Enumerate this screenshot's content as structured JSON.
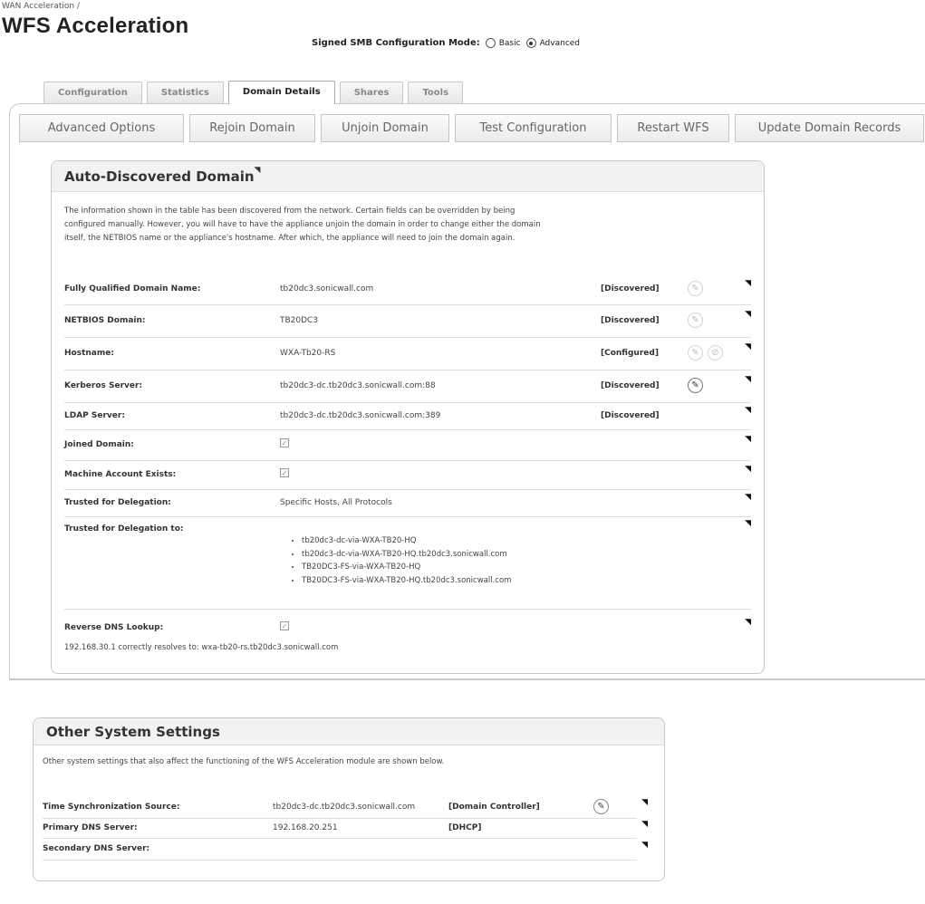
{
  "breadcrumb": "WAN Acceleration /",
  "title": "WFS Acceleration",
  "smb_mode": {
    "label": "Signed SMB Configuration Mode:",
    "options": [
      {
        "label": "Basic",
        "selected": false
      },
      {
        "label": "Advanced",
        "selected": true
      }
    ]
  },
  "tabs": [
    {
      "label": "Configuration",
      "active": false
    },
    {
      "label": "Statistics",
      "active": false
    },
    {
      "label": "Domain Details",
      "active": true
    },
    {
      "label": "Shares",
      "active": false
    },
    {
      "label": "Tools",
      "active": false
    }
  ],
  "buttons": [
    "Advanced Options",
    "Rejoin Domain",
    "Unjoin Domain",
    "Test Configuration",
    "Restart WFS",
    "Update Domain Records"
  ],
  "auto_domain": {
    "title": "Auto-Discovered Domain",
    "description_lines": [
      "The information shown in the table has been discovered from the network. Certain fields can be overridden by being",
      "configured manually. However, you will have to have the appliance unjoin the domain in order to change either the domain",
      "itself, the NETBIOS name or the appliance's hostname. After which, the appliance will need to join the domain again."
    ],
    "rows": [
      {
        "label": "Fully Qualified Domain Name:",
        "value": "tb20dc3.sonicwall.com",
        "status": "[Discovered]"
      },
      {
        "label": "NETBIOS Domain:",
        "value": "TB20DC3",
        "status": "[Discovered]"
      },
      {
        "label": "Hostname:",
        "value": "WXA-Tb20-RS",
        "status": "[Configured]"
      },
      {
        "label": "Kerberos Server:",
        "value": "tb20dc3-dc.tb20dc3.sonicwall.com:88",
        "status": "[Discovered]"
      },
      {
        "label": "LDAP Server:",
        "value": "tb20dc3-dc.tb20dc3.sonicwall.com:389",
        "status": "[Discovered]"
      },
      {
        "label": "Joined Domain:",
        "value": "",
        "status": ""
      },
      {
        "label": "Machine Account Exists:",
        "value": "",
        "status": ""
      },
      {
        "label": "Trusted for Delegation:",
        "value": "Specific Hosts, All Protocols",
        "status": ""
      },
      {
        "label": "Trusted for Delegation to:",
        "value": "",
        "status": ""
      },
      {
        "label": "Reverse DNS Lookup:",
        "value": "",
        "status": ""
      }
    ],
    "delegation_hosts": [
      "tb20dc3-dc-via-WXA-TB20-HQ",
      "tb20dc3-dc-via-WXA-TB20-HQ.tb20dc3.sonicwall.com",
      "TB20DC3-FS-via-WXA-TB20-HQ",
      "TB20DC3-FS-via-WXA-TB20-HQ.tb20dc3.sonicwall.com"
    ],
    "reverse_dns_note": "192.168.30.1 correctly resolves to: wxa-tb20-rs.tb20dc3.sonicwall.com"
  },
  "other_settings": {
    "title": "Other System Settings",
    "description": "Other system settings that also affect the functioning of the WFS Acceleration module are shown below.",
    "rows": [
      {
        "label": "Time Synchronization Source:",
        "value": "tb20dc3-dc.tb20dc3.sonicwall.com",
        "status": "[Domain Controller]"
      },
      {
        "label": "Primary DNS Server:",
        "value": "192.168.20.251",
        "status": "[DHCP]"
      },
      {
        "label": "Secondary DNS Server:",
        "value": "",
        "status": ""
      }
    ]
  },
  "icons": {
    "edit": "pencil-icon",
    "clear": "no-entry-icon",
    "menu": "small-triangle-arrow-icon",
    "checkbox": "checked-checkbox-disabled"
  }
}
